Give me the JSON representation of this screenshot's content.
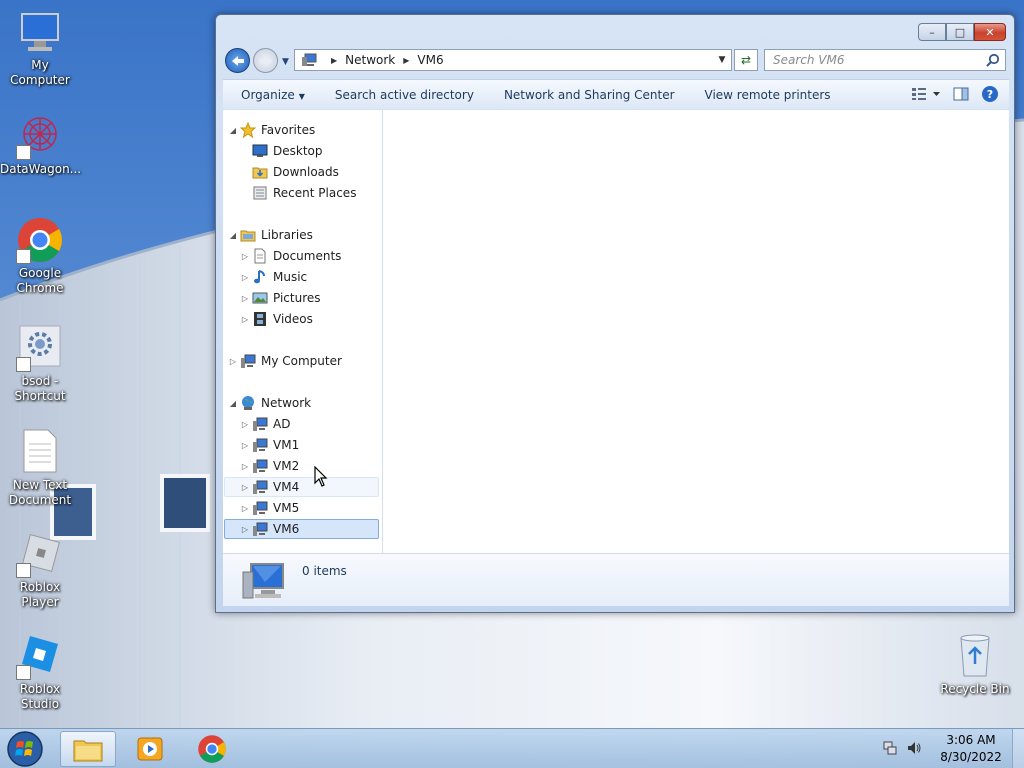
{
  "desktop": {
    "icons": [
      {
        "label": "My Computer"
      },
      {
        "label": "DataWagon..."
      },
      {
        "label": "Google Chrome"
      },
      {
        "label": "bsod - Shortcut"
      },
      {
        "label": "New Text Document"
      },
      {
        "label": "Roblox Player"
      },
      {
        "label": "Roblox Studio"
      },
      {
        "label": "Recycle Bin"
      }
    ]
  },
  "explorer": {
    "address": {
      "segments": [
        "Network",
        "VM6"
      ]
    },
    "search": {
      "placeholder": "Search VM6"
    },
    "commands": {
      "organize": "Organize",
      "search_ad": "Search active directory",
      "network_sharing": "Network and Sharing Center",
      "remote_printers": "View remote printers"
    },
    "nav": {
      "favorites": "Favorites",
      "desktop": "Desktop",
      "downloads": "Downloads",
      "recent_places": "Recent Places",
      "libraries": "Libraries",
      "documents": "Documents",
      "music": "Music",
      "pictures": "Pictures",
      "videos": "Videos",
      "my_computer": "My Computer",
      "network": "Network",
      "ad": "AD",
      "vm1": "VM1",
      "vm2": "VM2",
      "vm4": "VM4",
      "vm5": "VM5",
      "vm6": "VM6"
    },
    "details": {
      "count": "0 items"
    }
  },
  "taskbar": {
    "time": "3:06 AM",
    "date": "8/30/2022"
  },
  "colors": {
    "selection": "#d5e6fb",
    "selection_border": "#84acdd",
    "command_text": "#1e395b",
    "close_button": "#c8432e"
  }
}
